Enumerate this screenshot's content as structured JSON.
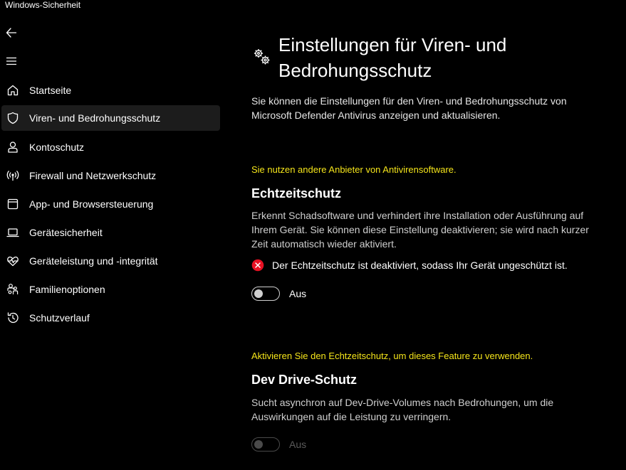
{
  "window": {
    "title": "Windows-Sicherheit"
  },
  "sidebar": {
    "items": [
      {
        "label": "Startseite",
        "icon": "home-icon"
      },
      {
        "label": "Viren- und Bedrohungsschutz",
        "icon": "shield-icon",
        "selected": true
      },
      {
        "label": "Kontoschutz",
        "icon": "person-icon"
      },
      {
        "label": "Firewall und Netzwerkschutz",
        "icon": "antenna-icon"
      },
      {
        "label": "App- und Browsersteuerung",
        "icon": "app-window-icon"
      },
      {
        "label": "Gerätesicherheit",
        "icon": "laptop-icon"
      },
      {
        "label": "Geräteleistung und -integrität",
        "icon": "heart-pulse-icon"
      },
      {
        "label": "Familienoptionen",
        "icon": "family-icon"
      },
      {
        "label": "Schutzverlauf",
        "icon": "history-icon"
      }
    ]
  },
  "main": {
    "title": "Einstellungen für Viren- und Bedrohungsschutz",
    "title_line1": "Einstellungen für Viren- und",
    "title_line2": "Bedrohungsschutz",
    "description": "Sie können die Einstellungen für den Viren- und Bedrohungsschutz von Microsoft Defender Antivirus anzeigen und aktualisieren.",
    "realtime": {
      "note": "Sie nutzen andere Anbieter von Antivirensoftware.",
      "title": "Echtzeitschutz",
      "description": "Erkennt Schadsoftware und verhindert ihre Installation oder Ausführung auf Ihrem Gerät. Sie können diese Einstellung deaktivieren; sie wird nach kurzer Zeit automatisch wieder aktiviert.",
      "status": "Der Echtzeitschutz ist deaktiviert, sodass Ihr Gerät ungeschützt ist.",
      "toggle_label": "Aus",
      "toggle_on": false
    },
    "devdrive": {
      "note": "Aktivieren Sie den Echtzeitschutz, um dieses Feature zu verwenden.",
      "title": "Dev Drive-Schutz",
      "description": "Sucht asynchron auf Dev-Drive-Volumes nach Bedrohungen, um die Auswirkungen auf die Leistung zu verringern.",
      "toggle_label": "Aus",
      "toggle_on": false,
      "toggle_enabled": false
    }
  },
  "colors": {
    "background": "#000000",
    "selected": "#1c1c1c",
    "note": "#f5e51a",
    "error": "#e81123"
  }
}
